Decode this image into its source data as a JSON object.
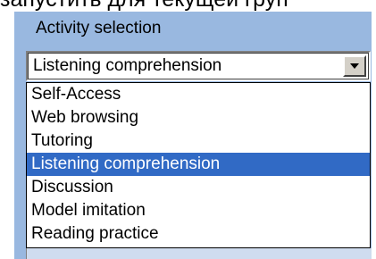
{
  "header": {
    "cut_text": "запустить для текущей груп"
  },
  "activity": {
    "label": "Activity selection",
    "selected_value": "Listening comprehension",
    "options": [
      {
        "label": "Self-Access"
      },
      {
        "label": "Web browsing"
      },
      {
        "label": "Tutoring"
      },
      {
        "label": "Listening comprehension"
      },
      {
        "label": "Discussion"
      },
      {
        "label": "Model imitation"
      },
      {
        "label": "Reading practice"
      }
    ],
    "highlighted_index": 3
  },
  "colors": {
    "panel": "#99b8e0",
    "highlight": "#316ac5",
    "button_face": "#d4d0c8"
  },
  "icons": {
    "dropdown": "triangle-down-icon"
  }
}
